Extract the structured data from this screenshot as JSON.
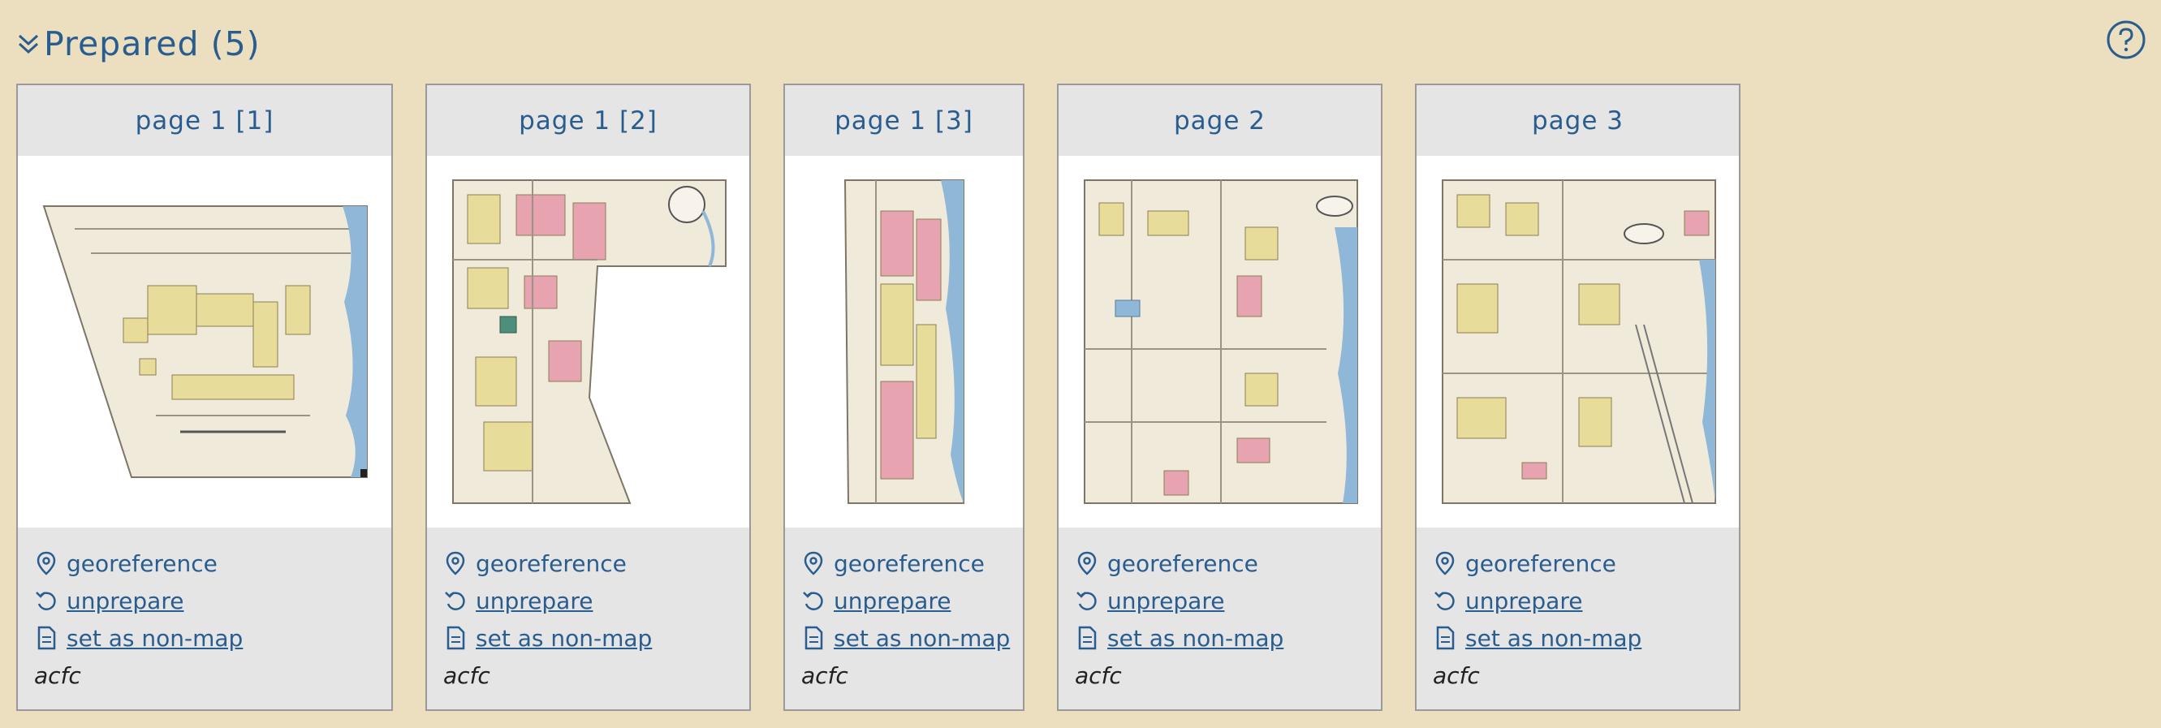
{
  "section": {
    "title": "Prepared (5)",
    "collapse_icon": "chevron-double-down-icon",
    "help_icon": "question-circle-icon"
  },
  "colors": {
    "background": "#ebdfbf",
    "card": "#e5e5e5",
    "accent": "#2a5d8f",
    "building_yellow": "#e8dc9a",
    "building_pink": "#e7a3b0",
    "water": "#8fb7d8"
  },
  "actions": {
    "georeference": "georeference",
    "unprepare": "unprepare",
    "set_non_map": " set as non-map",
    "georeference_icon": "map-pin-icon",
    "unprepare_icon": "undo-icon",
    "non_map_icon": "document-icon"
  },
  "cards": [
    {
      "title": "page 1 [1]",
      "owner": "acfc"
    },
    {
      "title": "page 1 [2]",
      "owner": "acfc"
    },
    {
      "title": "page 1 [3]",
      "owner": "acfc"
    },
    {
      "title": "page 2",
      "owner": "acfc"
    },
    {
      "title": "page 3",
      "owner": "acfc"
    }
  ]
}
